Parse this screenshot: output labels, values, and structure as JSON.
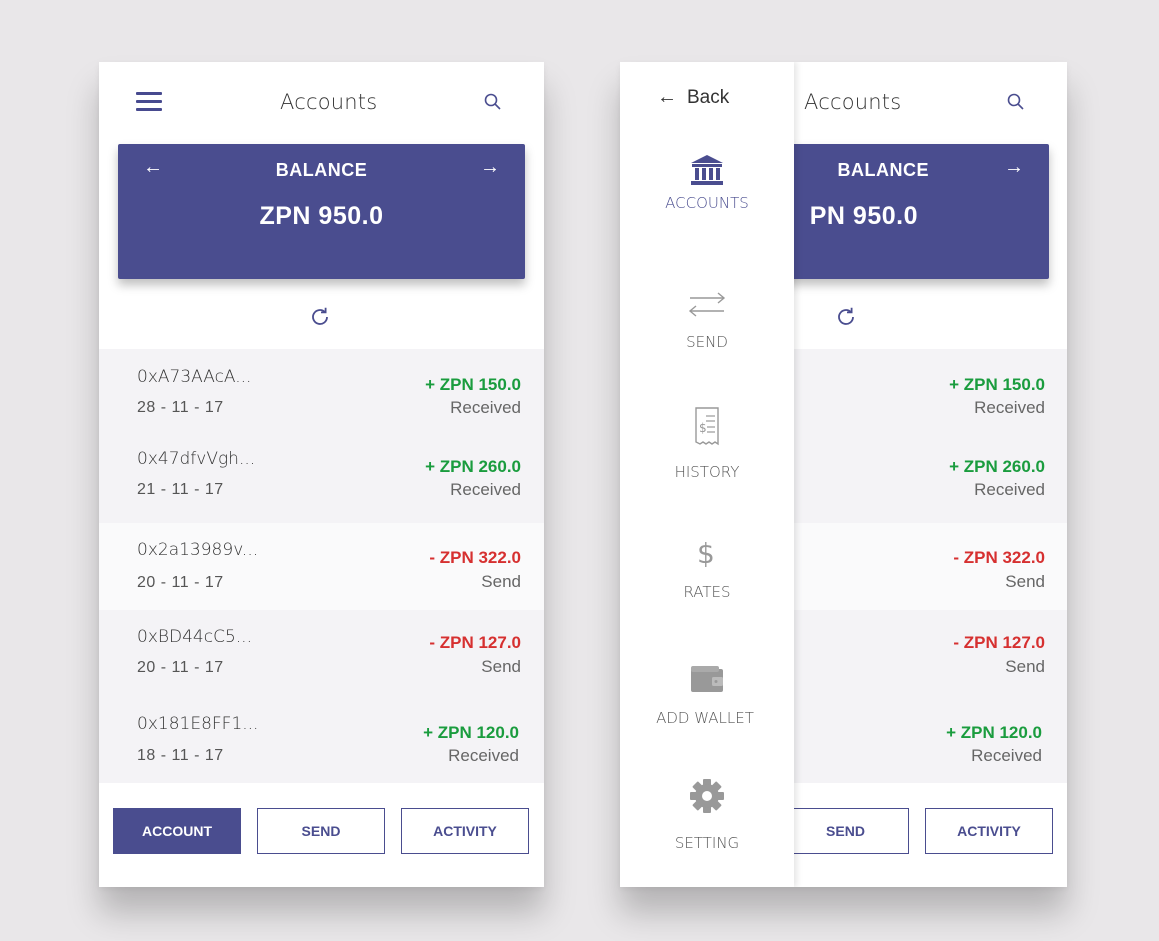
{
  "header": {
    "title": "Accounts"
  },
  "balance": {
    "label": "BALANCE",
    "amount": "ZPN 950.0",
    "amount_cropped": "PN 950.0"
  },
  "transactions": [
    {
      "address": "0xA73AAcA...",
      "date": "28 - 11 - 17",
      "amount": "+ ZPN 150.0",
      "status": "Received",
      "direction": "in"
    },
    {
      "address": "0x47dfvVgh...",
      "date": "21 - 11 - 17",
      "amount": "+ ZPN 260.0",
      "status": "Received",
      "direction": "in"
    },
    {
      "address": "0x2a13989v...",
      "date": "20 - 11 - 17",
      "amount": "- ZPN 322.0",
      "status": "Send",
      "direction": "out"
    },
    {
      "address": "0xBD44cC5...",
      "date": "20 - 11 - 17",
      "amount": "- ZPN 127.0",
      "status": "Send",
      "direction": "out"
    },
    {
      "address": "0x181E8FF1...",
      "date": "18 - 11 - 17",
      "amount": "+ ZPN 120.0",
      "status": "Received",
      "direction": "in"
    }
  ],
  "buttons": {
    "account": "ACCOUNT",
    "send": "SEND",
    "activity": "ACTIVITY"
  },
  "drawer": {
    "back": "Back",
    "items": [
      {
        "label": "ACCOUNTS",
        "icon": "bank-icon"
      },
      {
        "label": "SEND",
        "icon": "transfer-arrows-icon"
      },
      {
        "label": "HISTORY",
        "icon": "receipt-icon"
      },
      {
        "label": "RATES",
        "icon": "dollar-icon"
      },
      {
        "label": "ADD WALLET",
        "icon": "wallet-icon"
      },
      {
        "label": "SETTING",
        "icon": "gear-icon"
      }
    ]
  },
  "colors": {
    "accent": "#4a4d8f",
    "positive": "#1a9c3e",
    "negative": "#d63030",
    "background": "#e9e7e9"
  }
}
